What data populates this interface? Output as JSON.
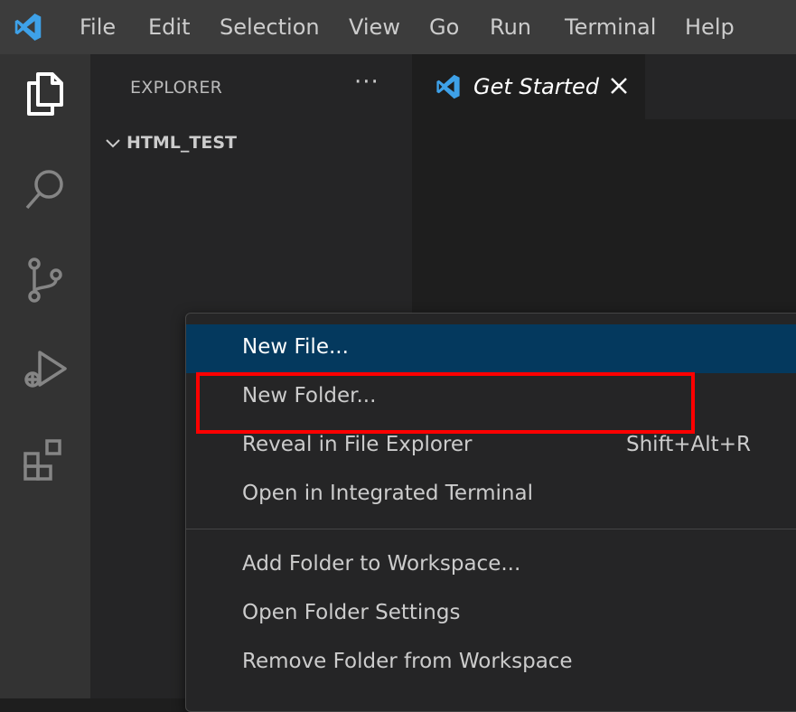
{
  "menubar": {
    "items": [
      "File",
      "Edit",
      "Selection",
      "View",
      "Go",
      "Run",
      "Terminal",
      "Help"
    ]
  },
  "activitybar": {
    "icons": [
      "explorer-icon",
      "search-icon",
      "source-control-icon",
      "run-debug-icon",
      "extensions-icon"
    ]
  },
  "sidebar": {
    "title": "EXPLORER",
    "more": "···",
    "folder": "HTML_TEST"
  },
  "tabs": [
    {
      "label": "Get Started",
      "icon": "vscode-logo-icon",
      "close_icon": "close-icon"
    }
  ],
  "context_menu": {
    "items": [
      {
        "label": "New File...",
        "shortcut": "",
        "selected": true
      },
      {
        "label": "New Folder...",
        "shortcut": "",
        "selected": false,
        "highlighted": true
      },
      {
        "label": "Reveal in File Explorer",
        "shortcut": "Shift+Alt+R",
        "selected": false
      },
      {
        "label": "Open in Integrated Terminal",
        "shortcut": "",
        "selected": false
      },
      {
        "label": "Add Folder to Workspace...",
        "shortcut": "",
        "selected": false
      },
      {
        "label": "Open Folder Settings",
        "shortcut": "",
        "selected": false
      },
      {
        "label": "Remove Folder from Workspace",
        "shortcut": "",
        "selected": false
      }
    ]
  },
  "colors": {
    "titlebar": "#3c3c3c",
    "activitybar": "#333333",
    "sidebar": "#252526",
    "editor": "#1e1e1e",
    "menu_selected": "#04395e",
    "highlight": "#ff0000",
    "vscode_blue": "#3ea1e8"
  }
}
